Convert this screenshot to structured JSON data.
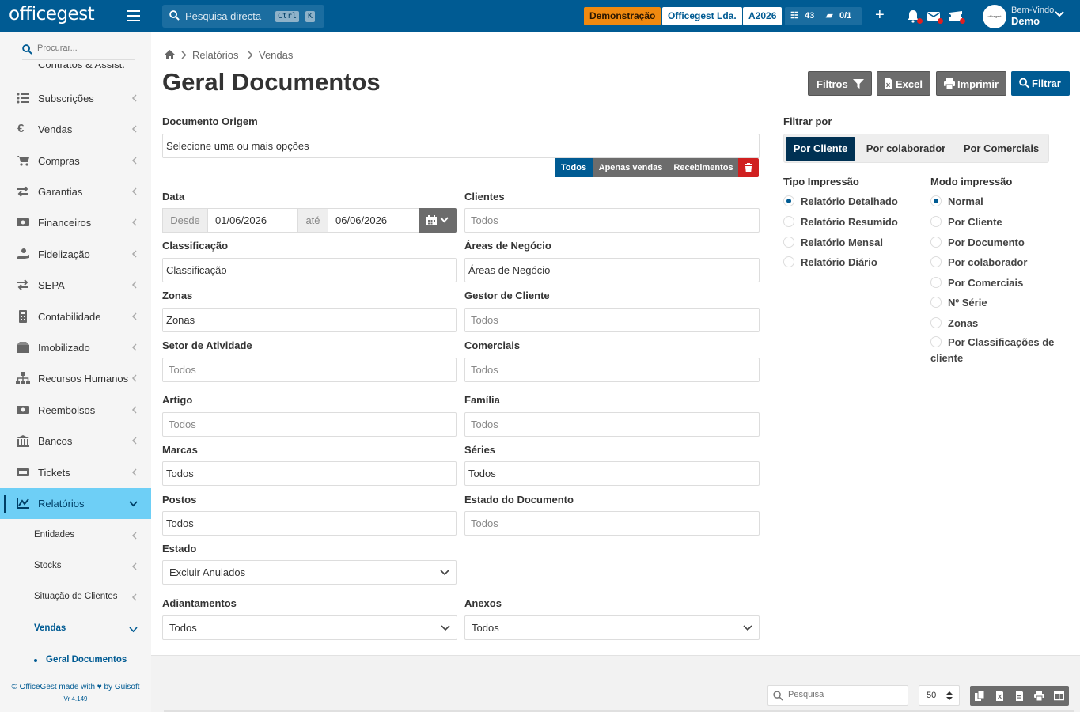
{
  "topbar": {
    "logo": "officegest",
    "search_placeholder": "Pesquisa directa",
    "shortcut_key1": "Ctrl",
    "shortcut_key2": "K",
    "demo_badge": "Demonstração",
    "company_badge": "Officegest Lda.",
    "year_badge": "A2026",
    "tasks_count": "43",
    "folders_count": "0/1",
    "avatar_text": "officegest",
    "welcome_text": "Bem-Vindo",
    "username": "Demo",
    "colors": {
      "bar": "#005b93",
      "demo": "#f0890f",
      "notification_dot": "#e02020"
    }
  },
  "sidebar": {
    "search_placeholder": "Procurar...",
    "cut_item": "Contratos & Assist.",
    "items": [
      {
        "label": "Subscrições",
        "icon": "list-icon"
      },
      {
        "label": "Vendas",
        "icon": "euro-icon"
      },
      {
        "label": "Compras",
        "icon": "cart-icon"
      },
      {
        "label": "Garantias",
        "icon": "exchange-icon"
      },
      {
        "label": "Financeiros",
        "icon": "money-icon"
      },
      {
        "label": "Fidelização",
        "icon": "hand-coin-icon"
      },
      {
        "label": "SEPA",
        "icon": "exchange-icon"
      },
      {
        "label": "Contabilidade",
        "icon": "calculator-icon"
      },
      {
        "label": "Imobilizado",
        "icon": "boxes-icon"
      },
      {
        "label": "Recursos Humanos",
        "icon": "sitemap-icon"
      },
      {
        "label": "Reembolsos",
        "icon": "money-icon"
      },
      {
        "label": "Bancos",
        "icon": "bank-icon"
      },
      {
        "label": "Tickets",
        "icon": "ticket-icon"
      },
      {
        "label": "Relatórios",
        "icon": "chart-icon"
      }
    ],
    "sub_items": [
      "Entidades",
      "Stocks",
      "Situação de Clientes",
      "Vendas"
    ],
    "leaf": "Geral Documentos",
    "footer": "© OfficeGest made with ♥ by Guisoft",
    "version": "Vr 4.149"
  },
  "breadcrumb": {
    "items": [
      "Relatórios",
      "Vendas"
    ]
  },
  "page": {
    "title": "Geral Documentos",
    "buttons": {
      "filters": "Filtros",
      "excel": "Excel",
      "print": "Imprimir",
      "filter": "Filtrar"
    }
  },
  "form": {
    "documento_origem": {
      "label": "Documento Origem",
      "placeholder": "Selecione uma ou mais opções",
      "options": [
        "Todos",
        "Apenas vendas",
        "Recebimentos"
      ]
    },
    "data": {
      "label": "Data",
      "from_label": "Desde",
      "from": "01/06/2026",
      "to_label": "até",
      "to": "06/06/2026"
    },
    "clientes": {
      "label": "Clientes",
      "placeholder": "Todos"
    },
    "classificacao": {
      "label": "Classificação",
      "value": "Classificação"
    },
    "areas_negocio": {
      "label": "Áreas de Negócio",
      "value": "Áreas de Negócio"
    },
    "zonas": {
      "label": "Zonas",
      "value": "Zonas"
    },
    "gestor_cliente": {
      "label": "Gestor de Cliente",
      "placeholder": "Todos"
    },
    "setor_atividade": {
      "label": "Setor de Atividade",
      "placeholder": "Todos"
    },
    "comerciais": {
      "label": "Comerciais",
      "placeholder": "Todos"
    },
    "artigo": {
      "label": "Artigo",
      "placeholder": "Todos"
    },
    "familia": {
      "label": "Família",
      "placeholder": "Todos"
    },
    "marcas": {
      "label": "Marcas",
      "value": "Todos"
    },
    "series": {
      "label": "Séries",
      "value": "Todos"
    },
    "postos": {
      "label": "Postos",
      "value": "Todos"
    },
    "estado_documento": {
      "label": "Estado do Documento",
      "placeholder": "Todos"
    },
    "estado": {
      "label": "Estado",
      "value": "Excluir Anulados"
    },
    "adiantamentos": {
      "label": "Adiantamentos",
      "value": "Todos"
    },
    "anexos": {
      "label": "Anexos",
      "value": "Todos"
    }
  },
  "filter_panel": {
    "filtrar_por": "Filtrar por",
    "tabs": [
      "Por Cliente",
      "Por colaborador",
      "Por Comerciais"
    ],
    "tipo_impressao": {
      "label": "Tipo Impressão",
      "options": [
        "Relatório Detalhado",
        "Relatório Resumido",
        "Relatório Mensal",
        "Relatório Diário"
      ]
    },
    "modo_impressao": {
      "label": "Modo impressão",
      "options": [
        "Normal",
        "Por Cliente",
        "Por Documento",
        "Por colaborador",
        "Por Comerciais",
        "Nº Série",
        "Zonas",
        "Por Classificações de cliente"
      ]
    }
  },
  "table_toolbar": {
    "search_placeholder": "Pesquisa",
    "page_size": "50"
  }
}
